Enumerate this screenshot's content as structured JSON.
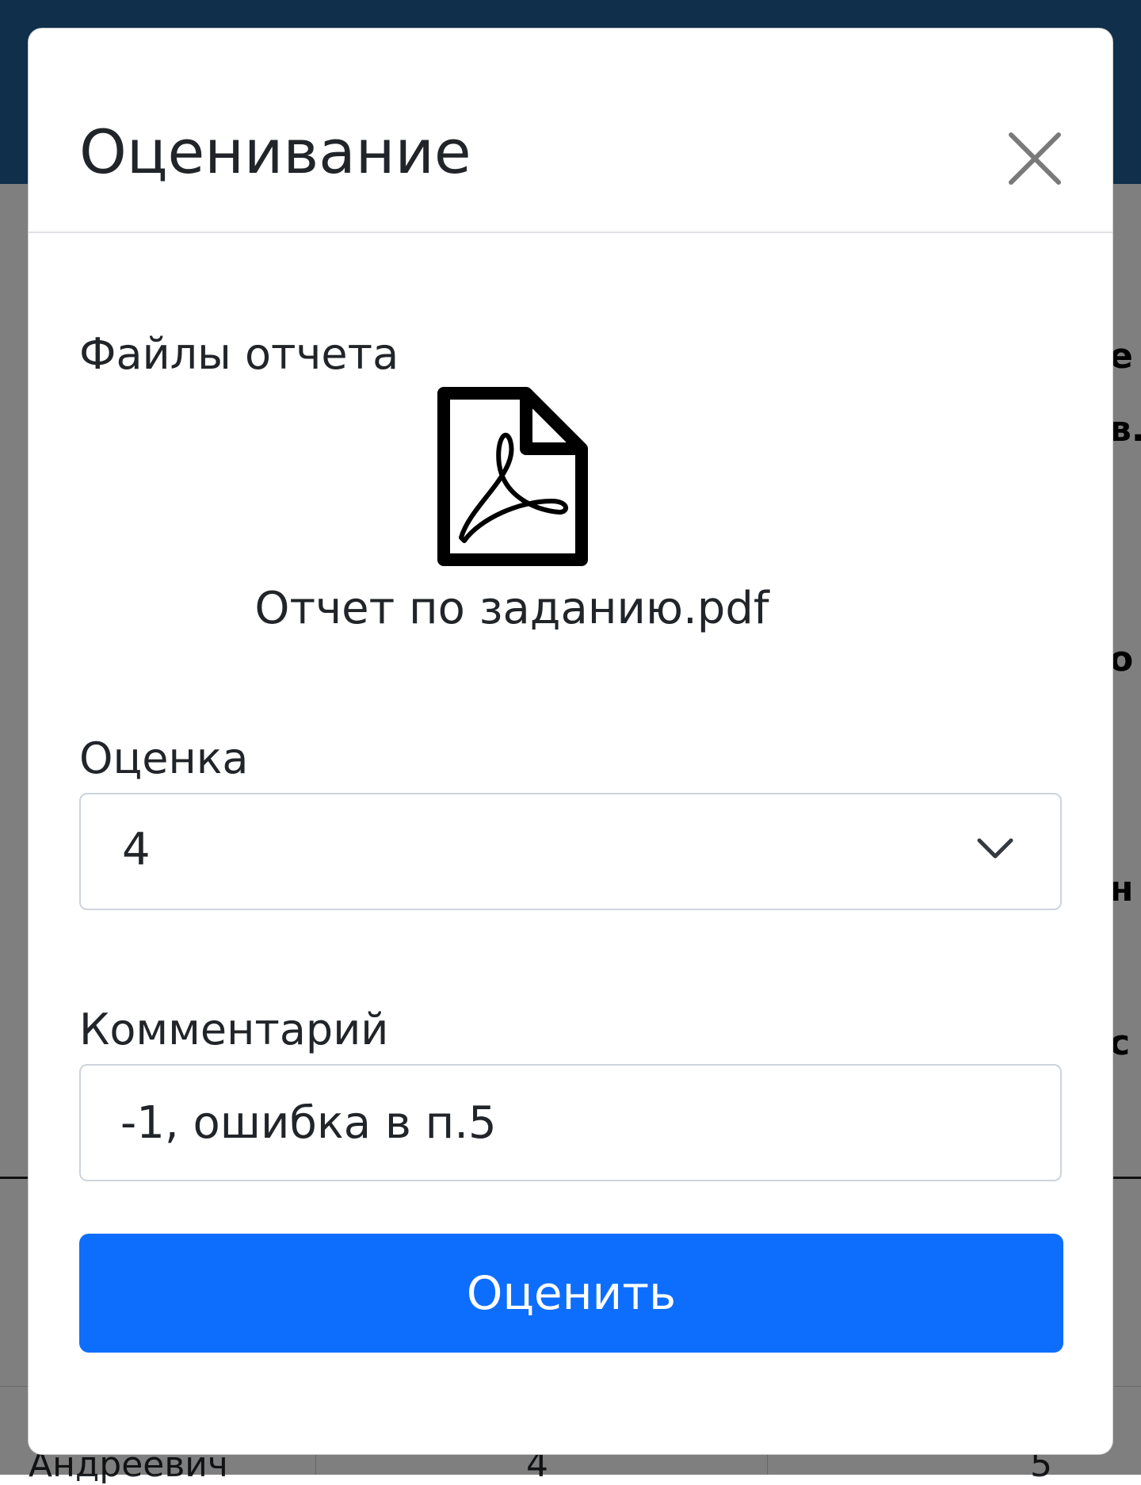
{
  "modal": {
    "title": "Оценивание",
    "close_icon": "close-icon",
    "files_label": "Файлы отчета",
    "file": {
      "icon": "pdf-file-icon",
      "name": "Отчет по заданию.pdf"
    },
    "grade": {
      "label": "Оценка",
      "selected_value": "4",
      "icon": "chevron-down-icon"
    },
    "comment": {
      "label": "Комментарий",
      "value": "-1, ошибка в п.5"
    },
    "submit_label": "Оценить"
  },
  "background": {
    "row_name_fragment": "Андреевич",
    "row_grade": "4",
    "row_value": "5",
    "header_fragments": [
      "е",
      "в.",
      "о",
      "н",
      "с"
    ]
  },
  "colors": {
    "navbar": "#1f5f97",
    "primary": "#0d6efd",
    "text": "#212529",
    "border": "#ced4da"
  }
}
